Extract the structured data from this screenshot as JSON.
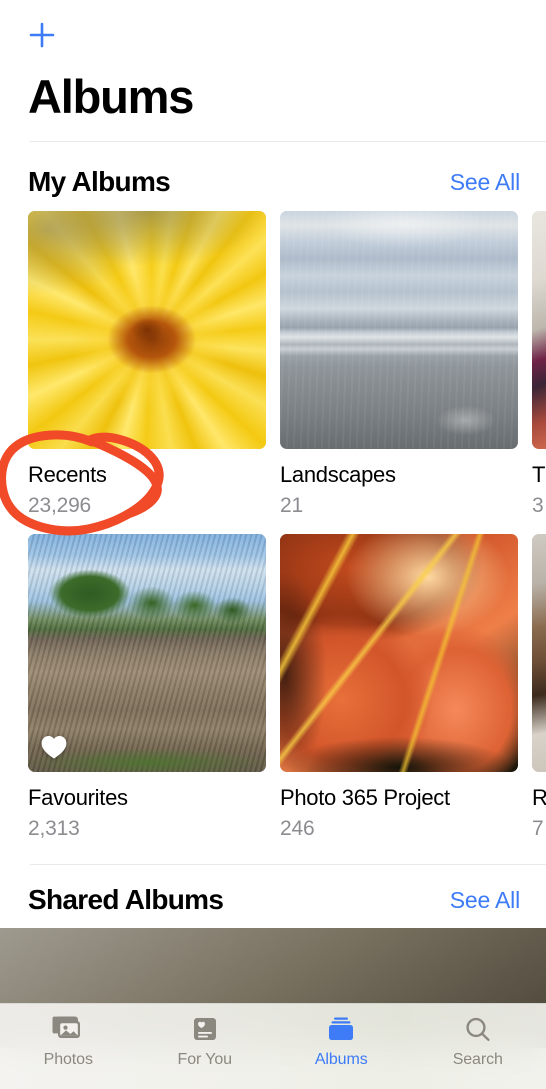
{
  "app": {
    "name": "Photos",
    "screen_title": "Albums",
    "accent_blue": "#3d7bf7",
    "annotation_color": "#f04a28",
    "secondary_text_color": "#8c8c91"
  },
  "navbar": {
    "add_button_label": "+",
    "add_button_icon": "plus-icon"
  },
  "sections": [
    {
      "id": "my-albums",
      "title": "My Albums",
      "see_all_label": "See All",
      "rows": [
        [
          {
            "name": "Recents",
            "count": "23,296",
            "art": "art-flower-yellow",
            "annotated": true,
            "favourite_badge": false
          },
          {
            "name": "Landscapes",
            "count": "21",
            "art": "art-beach",
            "annotated": false,
            "favourite_badge": false
          },
          {
            "name": "T",
            "count": "3",
            "art": "art-cloth",
            "annotated": false,
            "favourite_badge": false,
            "clipped": true
          }
        ],
        [
          {
            "name": "Favourites",
            "count": "2,313",
            "art": "art-field",
            "annotated": false,
            "favourite_badge": true
          },
          {
            "name": "Photo 365 Project",
            "count": "246",
            "art": "art-lily",
            "annotated": false,
            "favourite_badge": false
          },
          {
            "name": "R",
            "count": "7",
            "art": "art-shoe",
            "annotated": false,
            "favourite_badge": false,
            "clipped": true
          }
        ]
      ]
    },
    {
      "id": "shared-albums",
      "title": "Shared Albums",
      "see_all_label": "See All",
      "thumbs": [
        {
          "art": "art-stone"
        },
        {
          "art": "art-mist"
        },
        {
          "art": "art-edge"
        }
      ]
    }
  ],
  "annotation": {
    "shape": "hand-drawn-ellipse",
    "targets": "Recents album name and count"
  },
  "tabbar": {
    "tabs": [
      {
        "label": "Photos",
        "icon": "photos-stack-icon",
        "active": false
      },
      {
        "label": "For You",
        "icon": "for-you-heart-card-icon",
        "active": false
      },
      {
        "label": "Albums",
        "icon": "albums-folder-icon",
        "active": true
      },
      {
        "label": "Search",
        "icon": "magnifier-icon",
        "active": false
      }
    ]
  }
}
